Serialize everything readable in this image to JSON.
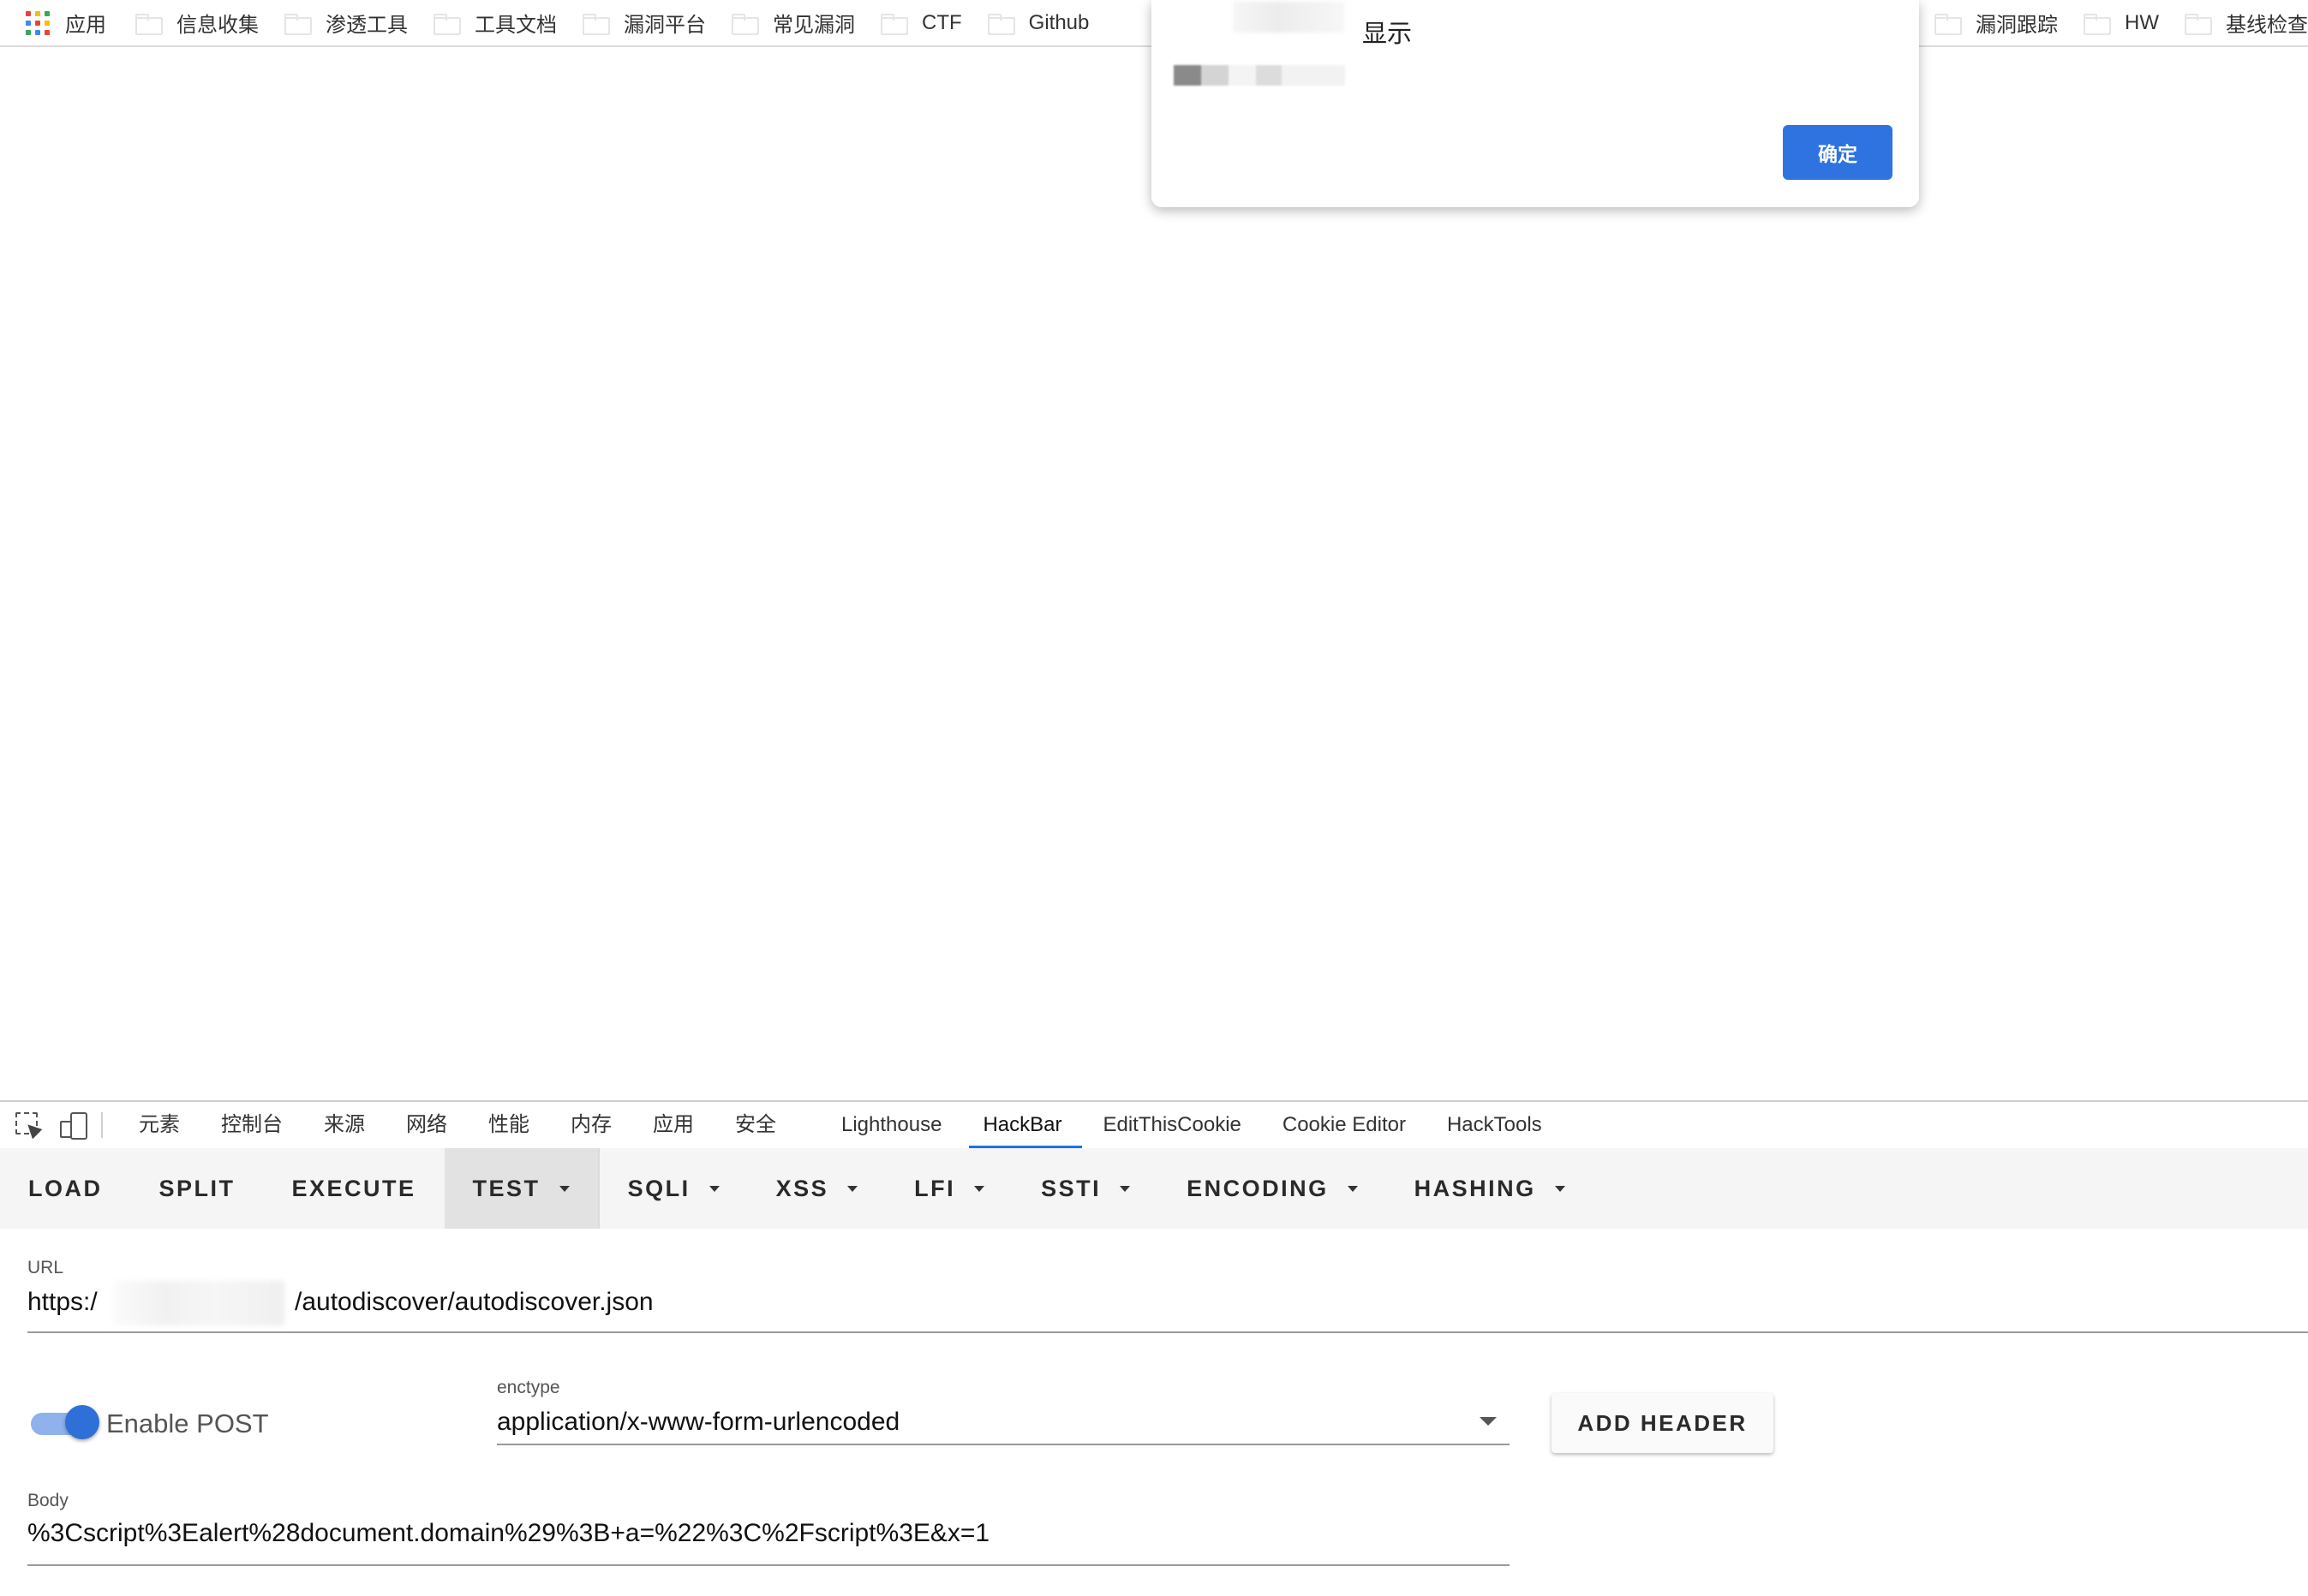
{
  "bookmarks": {
    "apps_label": "应用",
    "items": [
      "信息收集",
      "渗透工具",
      "工具文档",
      "漏洞平台",
      "常见漏洞",
      "CTF",
      "Github"
    ],
    "items_right": [
      "漏洞跟踪",
      "HW",
      "基线检查"
    ]
  },
  "dialog": {
    "title": "显示",
    "ok_label": "确定"
  },
  "devtools": {
    "tabs": [
      "元素",
      "控制台",
      "来源",
      "网络",
      "性能",
      "内存",
      "应用",
      "安全",
      "Lighthouse",
      "HackBar",
      "EditThisCookie",
      "Cookie Editor",
      "HackTools"
    ],
    "active_tab": "HackBar"
  },
  "hackbar": {
    "buttons": [
      {
        "label": "LOAD",
        "dropdown": false
      },
      {
        "label": "SPLIT",
        "dropdown": false
      },
      {
        "label": "EXECUTE",
        "dropdown": false
      },
      {
        "label": "TEST",
        "dropdown": true
      },
      {
        "label": "SQLI",
        "dropdown": true
      },
      {
        "label": "XSS",
        "dropdown": true
      },
      {
        "label": "LFI",
        "dropdown": true
      },
      {
        "label": "SSTI",
        "dropdown": true
      },
      {
        "label": "ENCODING",
        "dropdown": true
      },
      {
        "label": "HASHING",
        "dropdown": true
      }
    ],
    "active_button": "TEST",
    "url_label": "URL",
    "url_prefix": "https:/",
    "url_suffix": "/autodiscover/autodiscover.json",
    "enable_post_label": "Enable POST",
    "enable_post_on": true,
    "enctype_label": "enctype",
    "enctype_value": "application/x-www-form-urlencoded",
    "add_header_label": "ADD HEADER",
    "body_label": "Body",
    "body_value": "%3Cscript%3Ealert%28document.domain%29%3B+a=%22%3C%2Fscript%3E&x=1"
  },
  "colors": {
    "primary": "#2f73e0",
    "toggle_knob": "#2f6fd8",
    "toggle_track": "#8fb2ec",
    "active_tab_underline": "#1a73e8"
  }
}
